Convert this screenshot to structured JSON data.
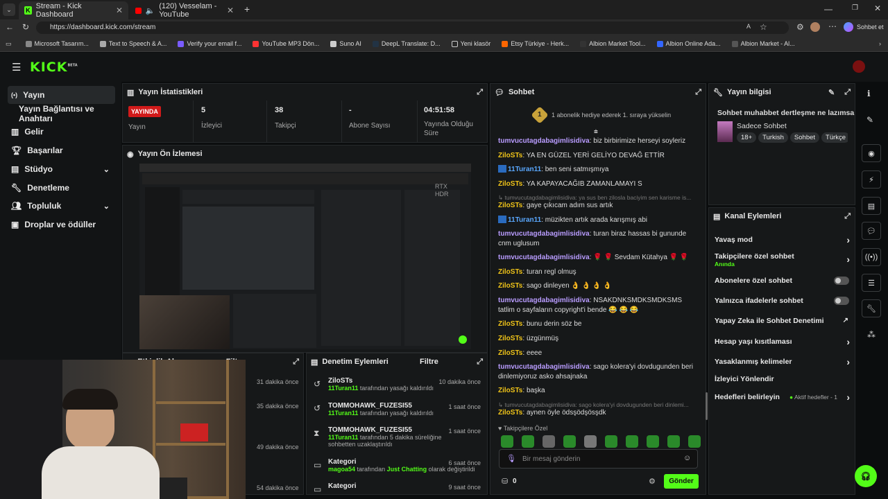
{
  "browser": {
    "tabs": [
      {
        "title": "Stream - Kick Dashboard"
      },
      {
        "title": "(120) Vesselam - YouTube"
      }
    ],
    "url": "https://dashboard.kick.com/stream",
    "right_label": "Sohbet et",
    "bookmarks": [
      "Microsoft Tasarım...",
      "Text to Speech & A...",
      "Verify your email f...",
      "YouTube MP3 Dön...",
      "Suno AI",
      "DeepL Translate: D...",
      "Yeni klasör",
      "Etsy Türkiye - Herk...",
      "Albion Market Tool...",
      "Albion Online Ada...",
      "Albion Market - Al..."
    ]
  },
  "kick": {
    "logo": "KICK",
    "beta": "BETA"
  },
  "sidebar": {
    "items": [
      {
        "label": "Yayın",
        "icon": "stream-icon"
      },
      {
        "label": "Yayın Bağlantısı ve Anahtarı",
        "icon": ""
      },
      {
        "label": "Gelir",
        "icon": "chart-icon"
      },
      {
        "label": "Başarılar",
        "icon": "trophy-icon"
      },
      {
        "label": "Stüdyo",
        "icon": "studio-icon"
      },
      {
        "label": "Denetleme",
        "icon": "wrench-icon"
      },
      {
        "label": "Topluluk",
        "icon": "people-icon"
      },
      {
        "label": "Droplar ve ödüller",
        "icon": "gift-icon"
      }
    ]
  },
  "stats": {
    "title": "Yayın İstatistikleri",
    "live_badge": "YAYINDA",
    "items": [
      {
        "value": "",
        "label": "Yayın"
      },
      {
        "value": "5",
        "label": "İzleyici"
      },
      {
        "value": "38",
        "label": "Takipçi"
      },
      {
        "value": "-",
        "label": "Abone Sayısı"
      },
      {
        "value": "04:51:58",
        "label": "Yayında Olduğu Süre"
      }
    ]
  },
  "preview": {
    "title": "Yayın Ön İzlemesi",
    "overlay": "RTX HDR"
  },
  "activity": {
    "title": "Etkinlik Akışı",
    "filter": "Filtre",
    "times": [
      "31 dakika önce",
      "35 dakika önce",
      "49 dakika önce",
      "54 dakika önce"
    ]
  },
  "moderation": {
    "title": "Denetim Eylemleri",
    "filter": "Filtre",
    "items": [
      {
        "title": "ZiloSTs",
        "user": "11Turan11",
        "desc": "tarafından yasağı kaldırıldı",
        "time": "10 dakika önce"
      },
      {
        "title": "TOMMOHAWK_FUZESI55",
        "user": "11Turan11",
        "desc": "tarafından yasağı kaldırıldı",
        "time": "1 saat önce"
      },
      {
        "title": "TOMMOHAWK_FUZESI55",
        "user": "11Turan11",
        "desc": "tarafından 5 dakika süreliğine sohbetten uzaklaştırıldı",
        "time": "1 saat önce"
      },
      {
        "title": "Kategori",
        "user": "magoa54",
        "desc": "tarafından",
        "extra": "Just Chatting",
        "desc2": "olarak değiştirildi",
        "time": "6 saat önce"
      },
      {
        "title": "Kategori",
        "user": "",
        "desc": "",
        "time": "9 saat önce"
      }
    ]
  },
  "chat": {
    "title": "Sohbet",
    "gift_banner": "1 abonelik hediye ederek 1. sıraya yükselin",
    "gift_rank": "1",
    "messages": [
      {
        "user": "tumvucutagdabagimlisidiva",
        "cls": "u1",
        "text": "biz birbirimize herseyi soyleriz"
      },
      {
        "user": "ZiloSTs",
        "cls": "u2",
        "text": "YA EN GÜZEL YERİ GELİYO DEVAĞ ETTİR"
      },
      {
        "user": "11Turan11",
        "cls": "u3",
        "text": "ben seni satmışmıya"
      },
      {
        "user": "ZiloSTs",
        "cls": "u2",
        "text": "YA KAPAYACAĞIB ZAMANLAMAYI S"
      },
      {
        "reply": "↳ tumvucutagdabagimlisidiva: ya sus ben zilosla baciyim sen karisme is...",
        "user": "ZiloSTs",
        "cls": "u2",
        "text": "gaye çıkıcam adım sus artık"
      },
      {
        "user": "11Turan11",
        "cls": "u3",
        "text": "müzikten artık arada karışmış abi"
      },
      {
        "user": "tumvucutagdabagimlisidiva",
        "cls": "u1",
        "text": "turan biraz hassas bi gununde cnm uglusum"
      },
      {
        "user": "tumvucutagdabagimlisidiva",
        "cls": "u1",
        "text": "🌹 🌹 Sevdam Kütahya 🌹 🌹"
      },
      {
        "user": "ZiloSTs",
        "cls": "u2",
        "text": "turan regl olmuş"
      },
      {
        "user": "ZiloSTs",
        "cls": "u2",
        "text": "sago dinleyen 👌 👌 👌 👌"
      },
      {
        "user": "tumvucutagdabagimlisidiva",
        "cls": "u1",
        "text": "NSAKDNKSMDKSMDKSMS tatlim o sayfaların copyright'i bende 😂 😂 😂"
      },
      {
        "user": "ZiloSTs",
        "cls": "u2",
        "text": "bunu derin söz be"
      },
      {
        "user": "ZiloSTs",
        "cls": "u2",
        "text": "üzgünmüş"
      },
      {
        "user": "ZiloSTs",
        "cls": "u2",
        "text": "eeee"
      },
      {
        "user": "tumvucutagdabagimlisidiva",
        "cls": "u1",
        "text": "sago kolera'yi dovdugunden beri dinlemiyoruz asko ahsajnaka"
      },
      {
        "user": "ZiloSTs",
        "cls": "u2",
        "text": "başka"
      },
      {
        "reply": "↳ tumvucutagdabagimlisidiva: sago kolera'yi dovdugunden beri dinlemi...",
        "user": "ZiloSTs",
        "cls": "u2",
        "text": "aynen öyle ödsşödşösşdk"
      }
    ],
    "followers_only": "Takipçilere Özel",
    "input_placeholder": "Bir mesaj gönderin",
    "count": "0",
    "send": "Gönder"
  },
  "stream_info": {
    "title": "Yayın bilgisi",
    "stream_title": "Sohbet muhabbet dertleşme ne lazımsa",
    "category": "Sadece Sohbet",
    "tags": [
      "18+",
      "Turkish",
      "Sohbet",
      "Türkçe"
    ]
  },
  "channel_actions": {
    "title": "Kanal Eylemleri",
    "items": [
      {
        "label": "Yavaş mod",
        "sub": "",
        "control": "chevron"
      },
      {
        "label": "Takipçilere özel sohbet",
        "sub": "Anında",
        "control": "chevron"
      },
      {
        "label": "Abonelere özel sohbet",
        "sub": "",
        "control": "toggle"
      },
      {
        "label": "Yalnızca ifadelerle sohbet",
        "sub": "",
        "control": "toggle"
      },
      {
        "label": "Yapay Zeka ile Sohbet Denetimi",
        "sub": "",
        "control": "external"
      },
      {
        "label": "Hesap yaşı kısıtlaması",
        "sub": "",
        "control": "chevron"
      },
      {
        "label": "Yasaklanmış kelimeler",
        "sub": "",
        "control": "chevron"
      },
      {
        "label": "İzleyici Yönlendir",
        "sub": "",
        "control": "none"
      },
      {
        "label": "Hedefleri belirleyin",
        "sub": "",
        "control": "chevron",
        "status": "Aktif hedefler - 1"
      }
    ]
  },
  "colors": {
    "accent": "#53fc18",
    "live": "#d11a1a",
    "panel": "#161819"
  }
}
